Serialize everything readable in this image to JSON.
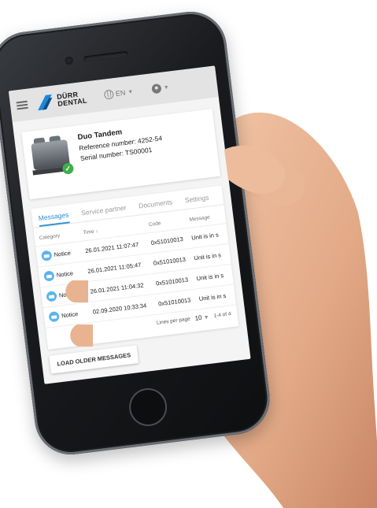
{
  "header": {
    "logo_line1": "DÜRR",
    "logo_line2": "DENTAL",
    "language": "EN"
  },
  "device": {
    "title": "Duo Tandem",
    "reference": "Reference number: 4252-54",
    "serial": "Serial number: TS00001"
  },
  "tabs": [
    {
      "label": "Messages"
    },
    {
      "label": "Service partner"
    },
    {
      "label": "Documents"
    },
    {
      "label": "Settings"
    }
  ],
  "table": {
    "headers": {
      "category": "Category",
      "time": "Time ↓",
      "code": "Code",
      "message": "Message"
    },
    "rows": [
      {
        "category": "Notice",
        "time": "26.01.2021 11:07:47",
        "code": "0x51010013",
        "message": "Unit is in s"
      },
      {
        "category": "Notice",
        "time": "26.01.2021 11:05:47",
        "code": "0x51010013",
        "message": "Unit is in s"
      },
      {
        "category": "Notice",
        "time": "26.01.2021 11:04:32",
        "code": "0x51010013",
        "message": "Unit is in s"
      },
      {
        "category": "Notice",
        "time": "02.09.2020 10:33:34",
        "code": "0x51010013",
        "message": "Unit is in s"
      }
    ]
  },
  "pager": {
    "label": "Lines per page",
    "value": "10",
    "range": "1-4 of 4"
  },
  "load_button": "LOAD OLDER MESSAGES",
  "colors": {
    "accent": "#2d8fd6",
    "status_ok": "#3cb04a",
    "notice": "#5db4ec",
    "logo_blue": "#1e88d8"
  }
}
